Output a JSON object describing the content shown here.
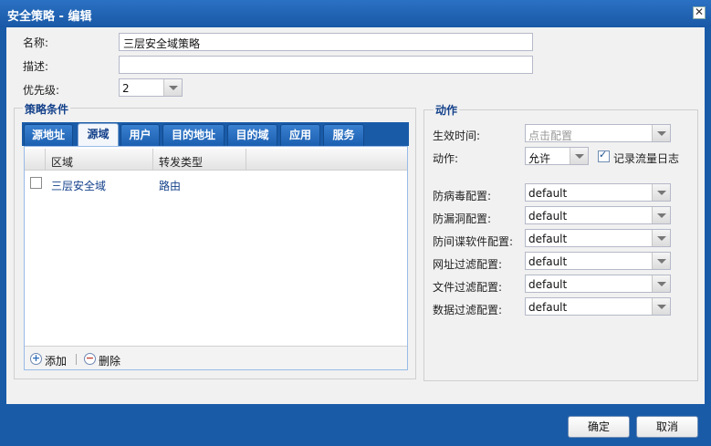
{
  "dialog": {
    "title": "安全策略 - 编辑",
    "close_glyph": "✕",
    "ok_label": "确定",
    "cancel_label": "取消"
  },
  "form": {
    "name_label": "名称:",
    "name_value": "三层安全域策略",
    "desc_label": "描述:",
    "desc_value": "",
    "priority_label": "优先级:",
    "priority_value": "2"
  },
  "conditions": {
    "legend": "策略条件",
    "tabs": [
      "源地址",
      "源域",
      "用户",
      "目的地址",
      "目的域",
      "应用",
      "服务"
    ],
    "active_tab": "源域",
    "columns": [
      "区域",
      "转发类型"
    ],
    "rows": [
      {
        "zone": "三层安全域",
        "forward_type": "路由",
        "checked": false
      }
    ],
    "add_label": "添加",
    "delete_label": "删除"
  },
  "action": {
    "legend": "动作",
    "time_label": "生效时间:",
    "time_placeholder": "点击配置",
    "action_label": "动作:",
    "action_value": "允许",
    "log_label": "记录流量日志",
    "log_checked": true,
    "profiles": [
      {
        "label": "防病毒配置:",
        "value": "default"
      },
      {
        "label": "防漏洞配置:",
        "value": "default"
      },
      {
        "label": "防间谍软件配置:",
        "value": "default"
      },
      {
        "label": "网址过滤配置:",
        "value": "default"
      },
      {
        "label": "文件过滤配置:",
        "value": "default"
      },
      {
        "label": "数据过滤配置:",
        "value": "default"
      }
    ]
  },
  "colors": {
    "titlebar": "#1a5ba8",
    "panel_bg": "#f1f1f1",
    "tab_active_text": "#15428b"
  }
}
